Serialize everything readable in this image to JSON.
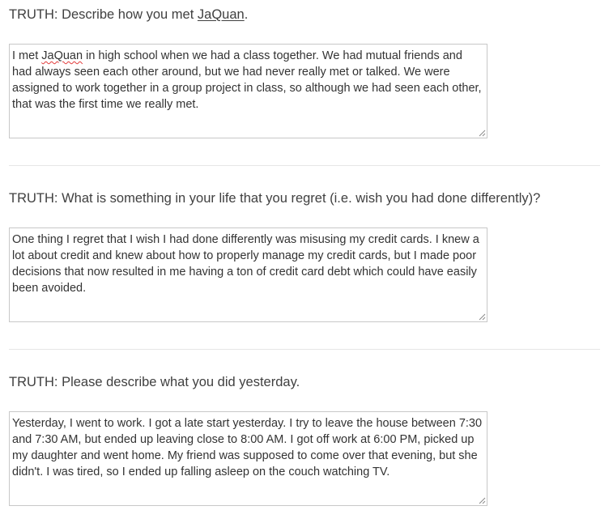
{
  "questions": [
    {
      "label_prefix": "TRUTH: Describe how you met ",
      "label_name": "JaQuan",
      "label_suffix": ".",
      "answer_before": "I met ",
      "answer_flagged": "JaQuan",
      "answer_after": " in high school when we had a class together. We had mutual friends and had always seen each other around, but we had never really met or talked. We were assigned to work together in a group project in class, so although we had seen each other, that was the first time we really met."
    },
    {
      "label": "TRUTH: What is something in your life that you regret (i.e. wish you had done differently)?",
      "answer": "One thing I regret that I wish I had done differently was misusing my credit cards. I knew a lot about credit and knew about how to properly manage my credit cards, but I made poor decisions that now resulted in me having a ton of credit card debt which could have easily been avoided."
    },
    {
      "label": "TRUTH: Please describe what you did yesterday.",
      "answer": "Yesterday, I went to work. I got a late start yesterday. I try to leave the house between 7:30 and 7:30 AM, but ended up leaving close to 8:00 AM. I got off work at 6:00 PM, picked up my daughter and went home. My friend was supposed to come over that evening, but she didn't. I was tired, so I ended up falling asleep on the couch watching TV."
    }
  ]
}
